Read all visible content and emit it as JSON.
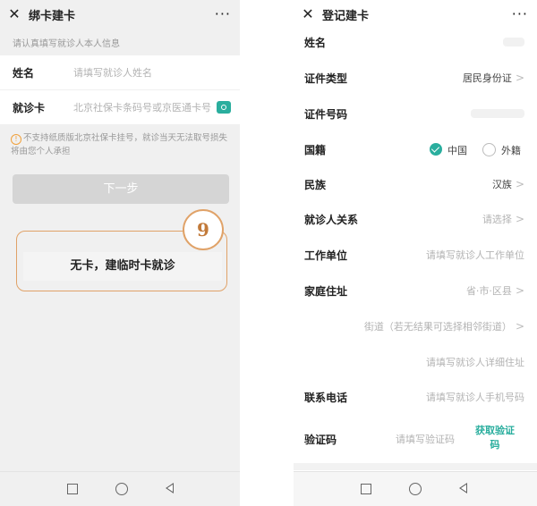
{
  "left": {
    "title": "绑卡建卡",
    "close_icon": "close-icon",
    "more_icon": "more-dots-icon",
    "more_text": "···",
    "hint": "请认真填写就诊人本人信息",
    "name_label": "姓名",
    "name_placeholder": "请填写就诊人姓名",
    "card_label": "就诊卡",
    "card_placeholder": "北京社保卡条码号或京医通卡号",
    "warning": "不支持纸质版北京社保卡挂号，就诊当天无法取号损失将由您个人承担",
    "next_button": "下一步",
    "no_card_option": "无卡，建临时卡就诊",
    "step_badge": "9",
    "accent_color": "#2aae9e",
    "highlight_color": "#e0a268"
  },
  "right": {
    "title": "登记建卡",
    "more_text": "···",
    "fields": {
      "name": {
        "label": "姓名"
      },
      "id_type": {
        "label": "证件类型",
        "value": "居民身份证"
      },
      "id_number": {
        "label": "证件号码"
      },
      "nationality": {
        "label": "国籍",
        "option_cn": "中国",
        "option_foreign": "外籍",
        "selected": "中国"
      },
      "ethnicity": {
        "label": "民族",
        "value": "汉族"
      },
      "relation": {
        "label": "就诊人关系",
        "value": "请选择"
      },
      "employer": {
        "label": "工作单位",
        "placeholder": "请填写就诊人工作单位"
      },
      "address": {
        "label": "家庭住址",
        "region_placeholder": "省·市·区县",
        "street_placeholder": "街道（若无结果可选择相邻街道）",
        "detail_placeholder": "请填写就诊人详细住址"
      },
      "phone": {
        "label": "联系电话",
        "placeholder": "请填写就诊人手机号码"
      },
      "verify": {
        "label": "验证码",
        "placeholder": "请填写验证码",
        "get_code": "获取验证码"
      }
    }
  },
  "navbar": {
    "back_icon": "nav-back-icon",
    "home_icon": "nav-home-icon",
    "recent_icon": "nav-recent-icon"
  }
}
